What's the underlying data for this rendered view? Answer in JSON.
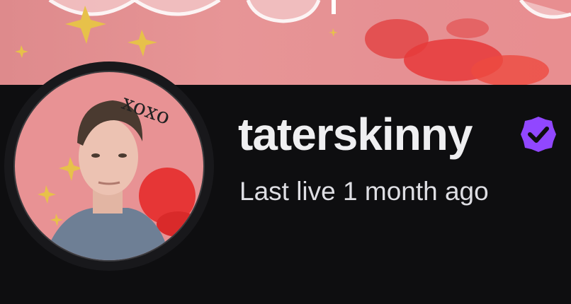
{
  "channel": {
    "name": "taterskinny",
    "status": "Last live 1 month ago",
    "verified": true,
    "verified_badge_color": "#9147ff"
  },
  "avatar": {
    "graffiti_text": "xoxo"
  },
  "colors": {
    "page_background": "#0e0e10",
    "banner_pink": "#e79596",
    "name_text": "#efeff1",
    "status_text": "#dedee3"
  }
}
